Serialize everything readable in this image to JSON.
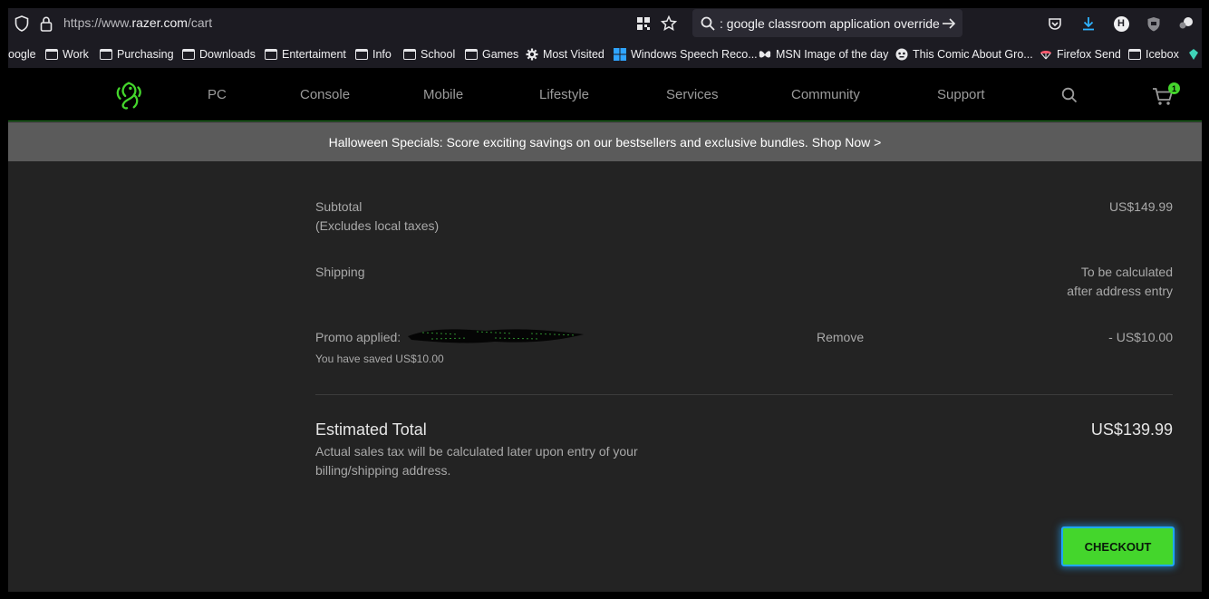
{
  "browser": {
    "url_prefix": "https://www.",
    "url_host": "razer.com",
    "url_path": "/cart",
    "search_text": ": google classroom application override",
    "profile_initial": "H",
    "bookmarks": [
      {
        "label": "oogle",
        "icon": "none"
      },
      {
        "label": "Work",
        "icon": "folder-icon"
      },
      {
        "label": "Purchasing",
        "icon": "folder-icon"
      },
      {
        "label": "Downloads",
        "icon": "folder-icon"
      },
      {
        "label": "Entertaiment",
        "icon": "folder-icon"
      },
      {
        "label": "Info",
        "icon": "folder-icon"
      },
      {
        "label": "School",
        "icon": "folder-icon"
      },
      {
        "label": "Games",
        "icon": "folder-icon"
      },
      {
        "label": "Most Visited",
        "icon": "gear-icon"
      },
      {
        "label": "Windows Speech Reco...",
        "icon": "windows-icon"
      },
      {
        "label": "MSN Image of the day",
        "icon": "butterfly-icon"
      },
      {
        "label": "This Comic About Gro...",
        "icon": "face-icon"
      },
      {
        "label": "Firefox Send",
        "icon": "parachute-icon"
      },
      {
        "label": "Icebox",
        "icon": "folder-icon"
      }
    ]
  },
  "site": {
    "nav": [
      "PC",
      "Console",
      "Mobile",
      "Lifestyle",
      "Services",
      "Community",
      "Support"
    ],
    "cart_count": "1",
    "brand_color": "#44d62c"
  },
  "banner": {
    "text": "Halloween Specials: Score exciting savings on our bestsellers and exclusive bundles. Shop Now >"
  },
  "summary": {
    "subtotal_label": "Subtotal",
    "subtotal_note": "(Excludes local taxes)",
    "subtotal_value": "US$149.99",
    "shipping_label": "Shipping",
    "shipping_value_1": "To be calculated",
    "shipping_value_2": "after address entry",
    "promo_label": "Promo applied:",
    "promo_saved": "You have saved US$10.00",
    "promo_remove": "Remove",
    "promo_value": "- US$10.00",
    "estimated_label": "Estimated Total",
    "estimated_value": "US$139.99",
    "estimated_note": "Actual sales tax will be calculated later upon entry of your billing/shipping address.",
    "checkout_label": "CHECKOUT"
  }
}
